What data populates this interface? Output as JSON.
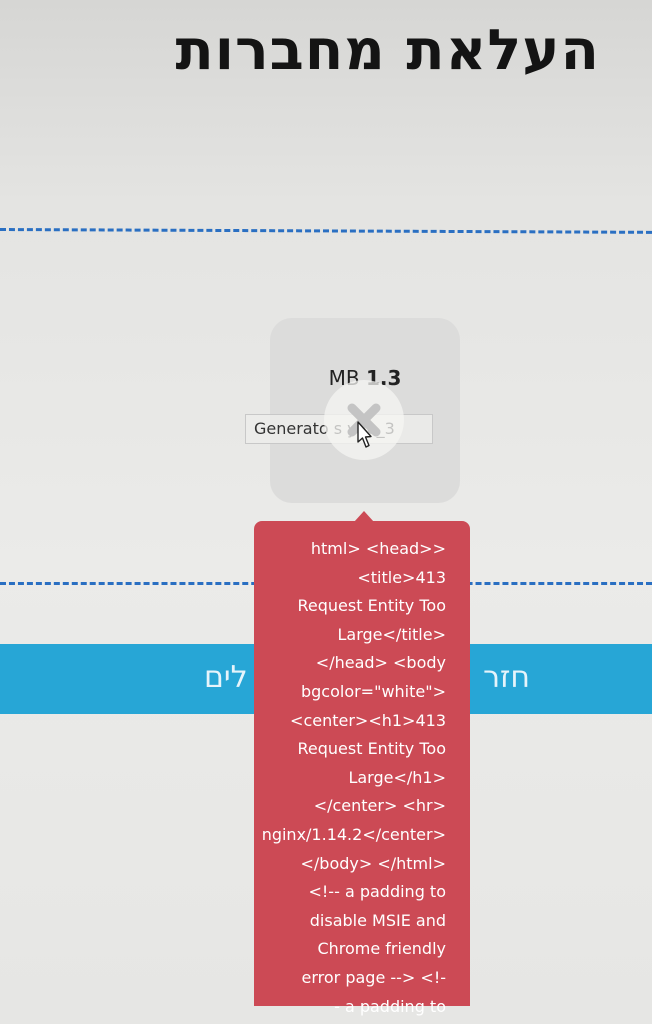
{
  "header": {
    "title": "העלאת מחברות"
  },
  "upload": {
    "file": {
      "size_value": "1.3",
      "size_unit": "MB",
      "name": "Generato s yho_3"
    },
    "error_message": "html> <head>>\n<title>413\nRequest Entity Too\nLarge</title>\n</head> <body\nbgcolor=\"white\">\n<center><h1>413\nRequest Entity Too\nLarge</h1>\n</center> <hr>\nnginx/1.14.2</center>\n</body> </html>\n<!-- a padding to\ndisable MSIE and\nChrome friendly\nerror page --> <!-\n- a padding to",
    "colors": {
      "error": "#cc4a55",
      "dropzone_border": "#2a6fc2",
      "action_bar": "#27a6d6"
    }
  },
  "action_bar": {
    "left_label": "לים",
    "right_label": "חזר"
  }
}
